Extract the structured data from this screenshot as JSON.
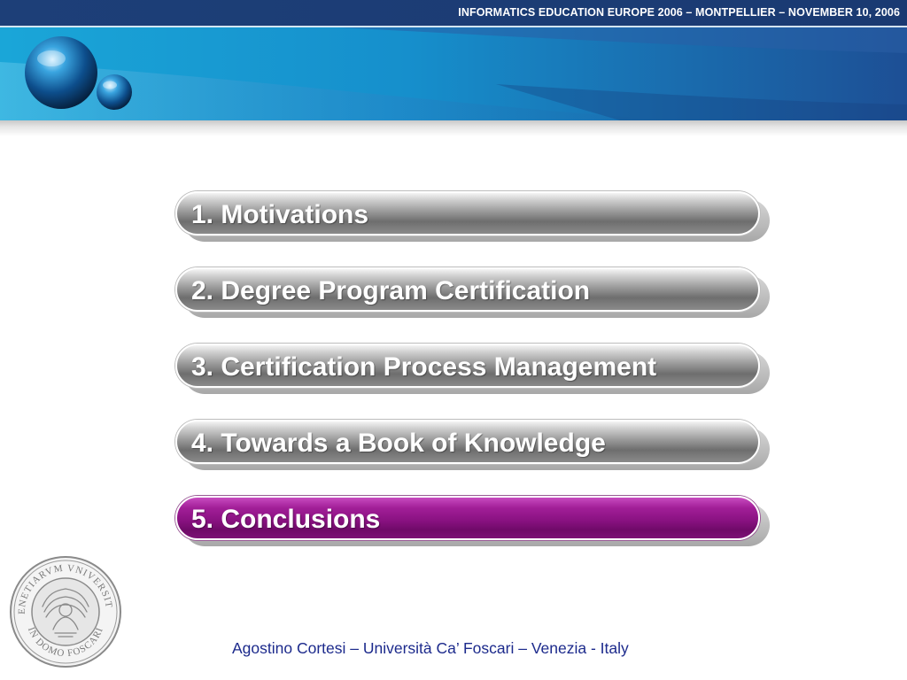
{
  "header": {
    "title": "INFORMATICS EDUCATION EUROPE 2006 – MONTPELLIER – NOVEMBER 10, 2006",
    "logo_icon": "globe-spheres-icon"
  },
  "agenda": {
    "items": [
      {
        "label": "1. Motivations",
        "active": false
      },
      {
        "label": "2. Degree Program Certification",
        "active": false
      },
      {
        "label": "3. Certification Process Management",
        "active": false
      },
      {
        "label": "4. Towards a Book of Knowledge",
        "active": false
      },
      {
        "label": "5. Conclusions",
        "active": true
      }
    ]
  },
  "seal": {
    "icon": "university-seal-icon",
    "text": "VENETIARUM UNIVERSITAS · IN DOMO FOSCARI"
  },
  "footer": {
    "credit": "Agostino Cortesi – Università Ca’ Foscari – Venezia - Italy"
  },
  "colors": {
    "header_blue": "#1f5aa0",
    "active_purple": "#8a1282",
    "inactive_gray": "#8c8c8c",
    "footer_text": "#1c2a8c"
  }
}
